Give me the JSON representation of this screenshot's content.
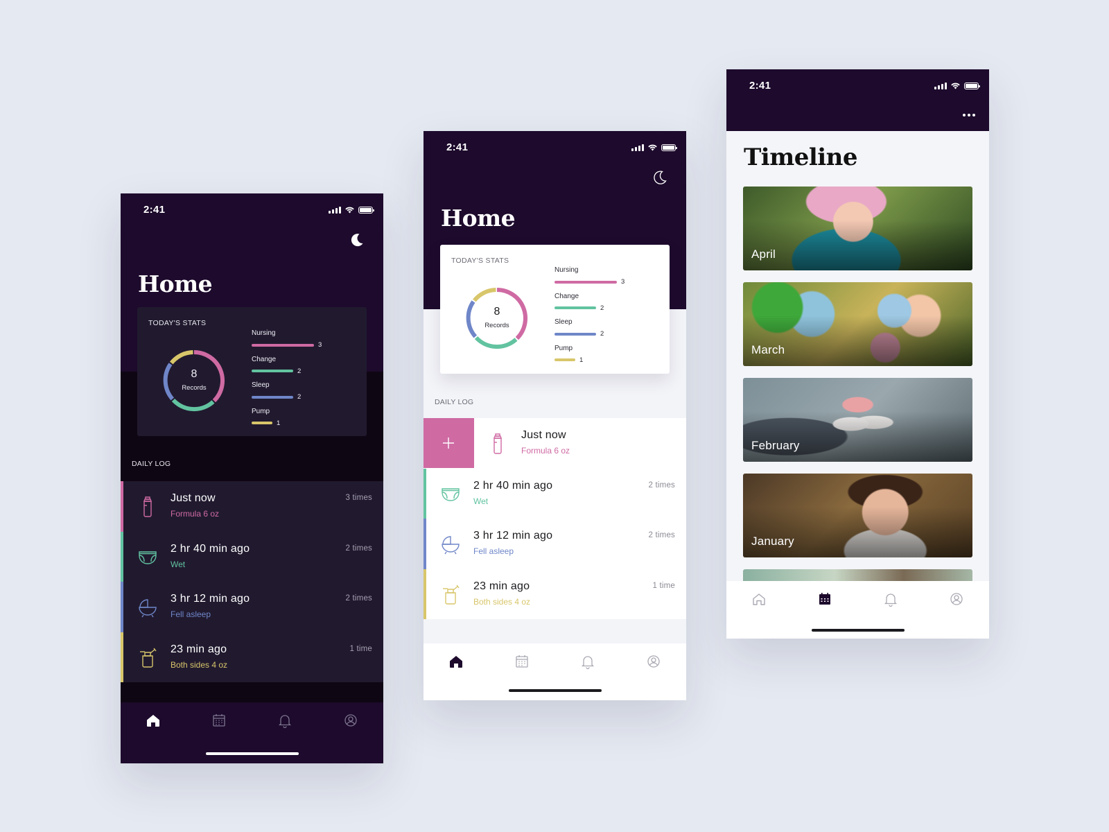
{
  "status_time": "2:41",
  "dark_home": {
    "title": "Home",
    "stats_label": "Today's stats",
    "donut": {
      "count": "8",
      "label": "Records"
    },
    "stats": [
      {
        "name": "Nursing",
        "count": "3",
        "color": "#cf6aa3"
      },
      {
        "name": "Change",
        "count": "2",
        "color": "#62c3a0"
      },
      {
        "name": "Sleep",
        "count": "2",
        "color": "#6f86c8"
      },
      {
        "name": "Pump",
        "count": "1",
        "color": "#d8c66a"
      }
    ],
    "daily_log_label": "Daily log",
    "log": [
      {
        "title": "Just now",
        "sub": "Formula 6 oz",
        "count": "3 times",
        "icon": "bottle-icon",
        "color": "#cf6aa3"
      },
      {
        "title": "2 hr 40 min ago",
        "sub": "Wet",
        "count": "2 times",
        "icon": "diaper-icon",
        "color": "#62c3a0"
      },
      {
        "title": "3 hr 12 min ago",
        "sub": "Fell asleep",
        "count": "2 times",
        "icon": "cradle-icon",
        "color": "#6f86c8"
      },
      {
        "title": "23 min ago",
        "sub": "Both sides 4 oz",
        "count": "1 time",
        "icon": "breast-pump-icon",
        "color": "#d8c66a"
      }
    ]
  },
  "light_home": {
    "title": "Home",
    "stats_label": "Today's stats",
    "donut": {
      "count": "8",
      "label": "Records"
    },
    "stats": [
      {
        "name": "Nursing",
        "count": "3",
        "color": "#cf6aa3"
      },
      {
        "name": "Change",
        "count": "2",
        "color": "#62c3a0"
      },
      {
        "name": "Sleep",
        "count": "2",
        "color": "#6f86c8"
      },
      {
        "name": "Pump",
        "count": "1",
        "color": "#d8c66a"
      }
    ],
    "daily_log_label": "Daily log",
    "add_label": "+",
    "log": [
      {
        "title": "Just now",
        "sub": "Formula 6 oz",
        "count": "",
        "icon": "bottle-icon",
        "color": "#cf6aa3"
      },
      {
        "title": "2 hr 40 min ago",
        "sub": "Wet",
        "count": "2 times",
        "icon": "diaper-icon",
        "color": "#62c3a0"
      },
      {
        "title": "3 hr 12 min ago",
        "sub": "Fell asleep",
        "count": "2 times",
        "icon": "cradle-icon",
        "color": "#6f86c8"
      },
      {
        "title": "23 min ago",
        "sub": "Both sides 4 oz",
        "count": "1 time",
        "icon": "breast-pump-icon",
        "color": "#d8c66a"
      }
    ]
  },
  "timeline": {
    "title": "Timeline",
    "months": [
      {
        "name": "April",
        "photo": "toddler-pink-hat-photo"
      },
      {
        "name": "March",
        "photo": "baby-with-balloons-photo"
      },
      {
        "name": "February",
        "photo": "baby-shoes-photo"
      },
      {
        "name": "January",
        "photo": "toddler-portrait-photo"
      }
    ]
  },
  "colors": {
    "header": "#1d0a2c",
    "nursing": "#cf6aa3",
    "change": "#62c3a0",
    "sleep": "#6f86c8",
    "pump": "#d8c66a",
    "background": "#e5e9f1"
  },
  "tabs": [
    "home-icon",
    "calendar-icon",
    "bell-icon",
    "profile-icon"
  ]
}
